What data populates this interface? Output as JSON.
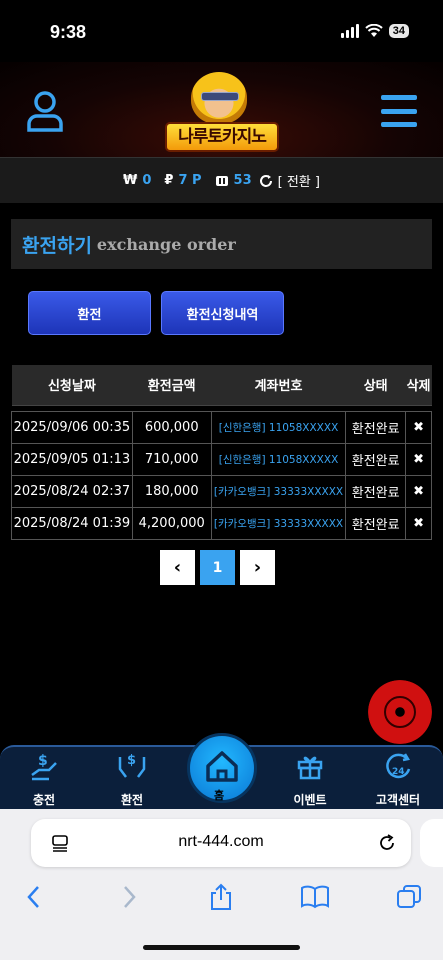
{
  "status_bar": {
    "time": "9:38",
    "battery": "34"
  },
  "header": {
    "logo_text": "나루토카지노"
  },
  "balance": {
    "won_symbol": "₩",
    "won_value": "0",
    "point_symbol": "₽",
    "point_value": "7 P",
    "chip_value": "53",
    "switch_label": "[ 전환 ]"
  },
  "panel": {
    "title_ko": "환전하기",
    "title_en": "exchange order"
  },
  "tabs": {
    "exchange": "환전",
    "history": "환전신청내역"
  },
  "table": {
    "headers": [
      "신청날짜",
      "환전금액",
      "계좌번호",
      "상태",
      "삭제"
    ],
    "rows": [
      {
        "date": "2025/09/06 00:35",
        "amount": "600,000",
        "account": "[신한은행] 11058XXXXX",
        "status": "환전완료",
        "delete": "✖"
      },
      {
        "date": "2025/09/05 01:13",
        "amount": "710,000",
        "account": "[신한은행] 11058XXXXX",
        "status": "환전완료",
        "delete": "✖"
      },
      {
        "date": "2025/08/24 02:37",
        "amount": "180,000",
        "account": "[카카오뱅크] 33333XXXXX",
        "status": "환전완료",
        "delete": "✖"
      },
      {
        "date": "2025/08/24 01:39",
        "amount": "4,200,000",
        "account": "[카카오뱅크] 33333XXXXX",
        "status": "환전완료",
        "delete": "✖"
      }
    ]
  },
  "pagination": {
    "prev": "‹",
    "current": "1",
    "next": "›"
  },
  "bottom_nav": {
    "charge": "충전",
    "exchange": "환전",
    "home": "홈",
    "event": "이벤트",
    "support": "고객센터"
  },
  "browser": {
    "url": "nrt-444.com"
  },
  "colors": {
    "accent": "#3aa3f0",
    "button": "#2440d0",
    "nav_bg": "#0b1f3b"
  }
}
